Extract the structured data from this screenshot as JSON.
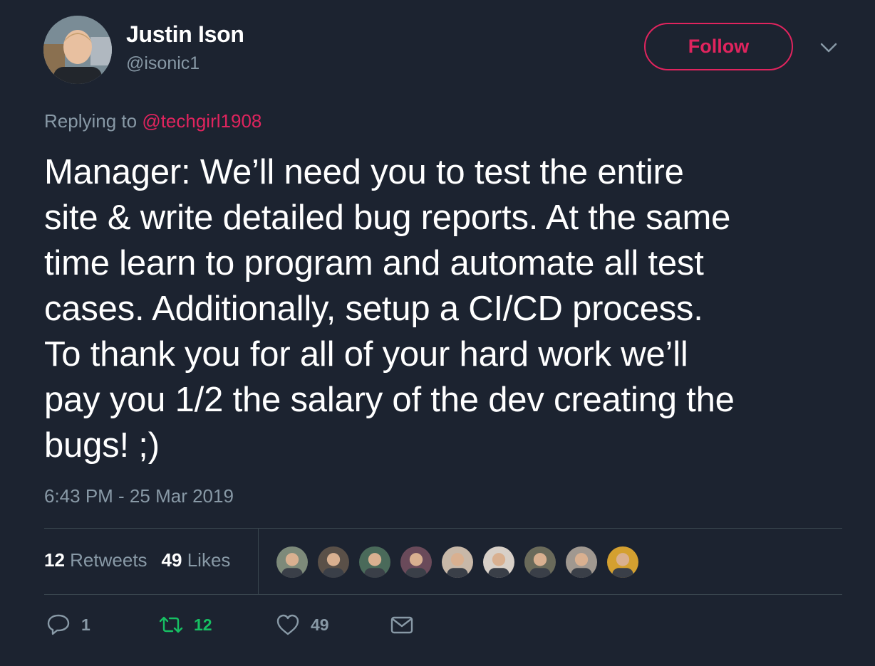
{
  "author": {
    "name": "Justin Ison",
    "handle": "@isonic1"
  },
  "follow_label": "Follow",
  "replying": {
    "prefix": "Replying to",
    "mention": "@techgirl1908"
  },
  "tweet_text": "Manager: We’ll need you to test the entire\nsite & write detailed bug reports. At the same\ntime learn to program and automate all test\ncases. Additionally, setup a CI/CD process.\nTo thank you for all of your hard work we’ll\npay you 1/2 the salary of the dev creating the\nbugs! ;)",
  "timestamp": "6:43 PM - 25 Mar 2019",
  "stats": {
    "retweets_count": "12",
    "retweets_label": "Retweets",
    "likes_count": "49",
    "likes_label": "Likes"
  },
  "likers": [
    {
      "name": "liker-avatar-1",
      "color": "#7d8a7a"
    },
    {
      "name": "liker-avatar-2",
      "color": "#5a5048"
    },
    {
      "name": "liker-avatar-3",
      "color": "#4a6a5a"
    },
    {
      "name": "liker-avatar-4",
      "color": "#6a4a5a"
    },
    {
      "name": "liker-avatar-5",
      "color": "#c8b8a8"
    },
    {
      "name": "liker-avatar-6",
      "color": "#d8d0c8"
    },
    {
      "name": "liker-avatar-7",
      "color": "#6a6a5a"
    },
    {
      "name": "liker-avatar-8",
      "color": "#a09890"
    },
    {
      "name": "liker-avatar-9",
      "color": "#d4a030"
    }
  ],
  "actions": {
    "reply_count": "1",
    "retweet_count": "12",
    "like_count": "49"
  },
  "colors": {
    "background": "#1c2330",
    "accent": "#e0245e",
    "muted": "#8899a6",
    "retweet": "#17bf63",
    "divider": "#38444d"
  },
  "icons": [
    "caret-down-icon",
    "reply-icon",
    "retweet-icon",
    "heart-icon",
    "mail-icon"
  ]
}
